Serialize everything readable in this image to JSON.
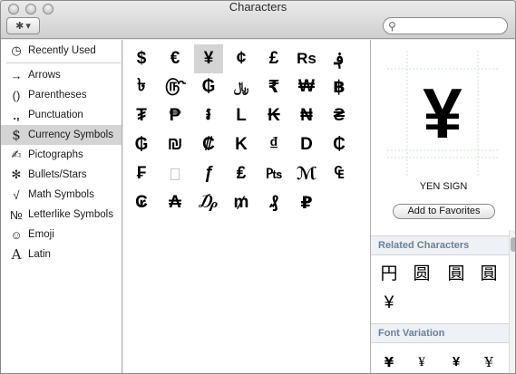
{
  "window": {
    "title": "Characters"
  },
  "toolbar": {
    "gear_icon": "gear-icon",
    "gear_glyph": "✱",
    "dropdown_glyph": "▾"
  },
  "search": {
    "placeholder": "",
    "value": "",
    "icon": "🔍"
  },
  "sidebar": {
    "items": [
      {
        "icon": "🕒",
        "label": "Recently Used"
      },
      {
        "icon": "→",
        "label": "Arrows"
      },
      {
        "icon": "()",
        "label": "Parentheses"
      },
      {
        "icon": ".,",
        "label": "Punctuation"
      },
      {
        "icon": "$",
        "label": "Currency Symbols"
      },
      {
        "icon": "✍",
        "label": "Pictographs"
      },
      {
        "icon": "✻",
        "label": "Bullets/Stars"
      },
      {
        "icon": "√",
        "label": "Math Symbols"
      },
      {
        "icon": "№",
        "label": "Letterlike Symbols"
      },
      {
        "icon": "☺",
        "label": "Emoji"
      },
      {
        "icon": "A",
        "label": "Latin"
      }
    ],
    "selected": "Currency Symbols"
  },
  "grid": {
    "rows": [
      [
        "$",
        "€",
        "¥",
        "¢",
        "£",
        "Rs",
        "؋"
      ],
      [
        "৳",
        "௹",
        "₲",
        "﷼",
        "₹",
        "₩",
        "฿"
      ],
      [
        "₮",
        "₱",
        "៛",
        "L",
        "₭",
        "₦",
        "₴"
      ],
      [
        "₲",
        "₪",
        "₡",
        "K",
        "₫",
        "D",
        "₵"
      ],
      [
        "₣",
        "",
        "ƒ",
        "₤",
        "₧",
        "ℳ",
        "₠"
      ],
      [
        "₢",
        "₳",
        "₯",
        "₥",
        "₰",
        "₽",
        ""
      ]
    ],
    "selected_char": "¥"
  },
  "preview": {
    "char": "¥",
    "name": "YEN SIGN",
    "add_favorites_label": "Add to Favorites"
  },
  "related": {
    "header": "Related Characters",
    "chars": [
      "円",
      "圆",
      "圓",
      "圓",
      "¥"
    ]
  },
  "font_variation": {
    "header": "Font Variation",
    "chars": [
      "¥",
      "¥",
      "¥",
      "¥"
    ]
  }
}
